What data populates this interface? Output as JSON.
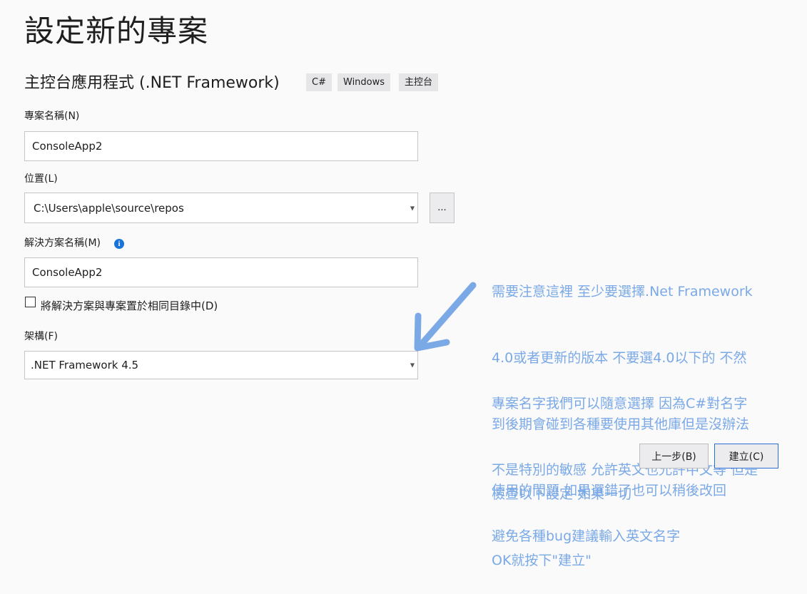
{
  "page": {
    "title": "設定新的專案"
  },
  "template": {
    "name": "主控台應用程式 (.NET Framework)",
    "tags": [
      "C#",
      "Windows",
      "主控台"
    ]
  },
  "project_name": {
    "label": "專案名稱(N)",
    "value": "ConsoleApp2"
  },
  "location": {
    "label": "位置(L)",
    "value": "C:\\Users\\apple\\source\\repos",
    "browse_label": "..."
  },
  "solution_name": {
    "label": "解決方案名稱(M)",
    "value": "ConsoleApp2",
    "info_icon": "i"
  },
  "same_dir": {
    "label": "將解決方案與專案置於相同目錄中(D)",
    "checked": false
  },
  "framework": {
    "label": "架構(F)",
    "value": ".NET Framework 4.5"
  },
  "buttons": {
    "back": "上一步(B)",
    "create": "建立(C)"
  },
  "annotations": {
    "note1": [
      "需要注意這裡 至少要選擇.Net Framework",
      "4.0或者更新的版本 不要選4.0以下的 不然",
      "到後期會碰到各種要使用其他庫但是沒辦法",
      "使用的問題 如果選錯了也可以稍後改回"
    ],
    "note2": [
      "專案名字我們可以隨意選擇 因為C#對名字",
      "不是特別的敏感 允許英文也允許中文等 但是",
      "避免各種bug建議輸入英文名字"
    ],
    "note3": [
      "檢查以下設定 如果一切",
      "OK就按下\"建立\""
    ],
    "arrow_color": "#7aa9e6"
  }
}
